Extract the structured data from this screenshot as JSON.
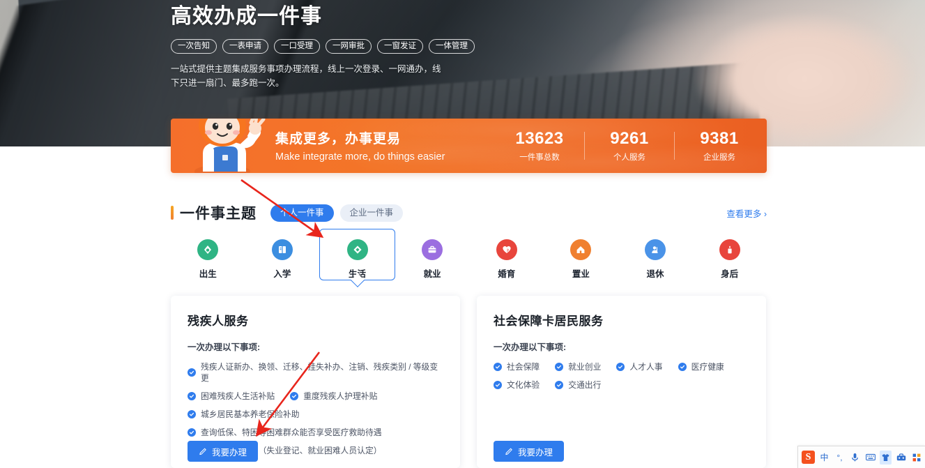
{
  "hero": {
    "title": "高效办成一件事",
    "tags": [
      "一次告知",
      "一表申请",
      "一口受理",
      "一网审批",
      "一窗发证",
      "一体管理"
    ],
    "description": "一站式提供主题集成服务事项办理流程，线上一次登录、一网通办，线下只进一扇门、最多跑一次。"
  },
  "banner": {
    "title": "集成更多，办事更易",
    "subtitle": "Make integrate more, do things easier",
    "mascot_icon": "mascot-character-icon",
    "stats": [
      {
        "value": "13623",
        "label": "一件事总数"
      },
      {
        "value": "9261",
        "label": "个人服务"
      },
      {
        "value": "9381",
        "label": "企业服务"
      }
    ]
  },
  "section": {
    "title": "一件事主题",
    "tabs": [
      {
        "label": "个人一件事",
        "active": true
      },
      {
        "label": "企业一件事",
        "active": false
      }
    ],
    "more_label": "查看更多",
    "more_icon": "chevron-right-icon"
  },
  "categories": [
    {
      "label": "出生",
      "icon": "birth-drop-icon",
      "color": "#2fb484",
      "selected": false
    },
    {
      "label": "入学",
      "icon": "book-icon",
      "color": "#3c8ee0",
      "selected": false
    },
    {
      "label": "生活",
      "icon": "life-diamond-icon",
      "color": "#2fb484",
      "selected": true
    },
    {
      "label": "就业",
      "icon": "briefcase-icon",
      "color": "#9b6ee0",
      "selected": false
    },
    {
      "label": "婚育",
      "icon": "heart-icon",
      "color": "#e8453c",
      "selected": false
    },
    {
      "label": "置业",
      "icon": "house-icon",
      "color": "#f08030",
      "selected": false
    },
    {
      "label": "退休",
      "icon": "retire-person-icon",
      "color": "#4a93e8",
      "selected": false
    },
    {
      "label": "身后",
      "icon": "candle-icon",
      "color": "#e8453c",
      "selected": false
    }
  ],
  "cards": [
    {
      "title": "残疾人服务",
      "subtitle": "一次办理以下事项:",
      "items": [
        "残疾人证新办、换领、迁移、挂失补办、注销、残疾类别 / 等级变更"
      ],
      "inline_rows": [
        [
          "困难残疾人生活补贴",
          "重度残疾人护理补贴"
        ]
      ],
      "more_items": [
        "城乡居民基本养老保险补助",
        "查询低保、特困等困难群众能否享受医疗救助待遇",
        "残疾人就业帮扶（失业登记、就业困难人员认定）"
      ],
      "button_label": "我要办理",
      "button_icon": "pencil-icon"
    },
    {
      "title": "社会保障卡居民服务",
      "subtitle": "一次办理以下事项:",
      "items": [],
      "inline_rows": [
        [
          "社会保障",
          "就业创业",
          "人才人事",
          "医疗健康"
        ],
        [
          "文化体验",
          "交通出行"
        ]
      ],
      "more_items": [],
      "button_label": "我要办理",
      "button_icon": "pencil-icon"
    }
  ],
  "annotations": {
    "arrow_1": "red-arrow-pointing-to-life-category",
    "arrow_2": "red-arrow-pointing-to-apply-button"
  },
  "ime": {
    "logo": "S",
    "items": [
      {
        "icon": "chinese-mode-icon",
        "glyph": "中"
      },
      {
        "icon": "punctuation-icon",
        "glyph": "°,"
      },
      {
        "icon": "microphone-icon",
        "glyph": "🎤"
      },
      {
        "icon": "keyboard-icon",
        "glyph": "⌨"
      },
      {
        "icon": "skin-icon",
        "glyph": "👕"
      },
      {
        "icon": "toolbox-icon",
        "glyph": "🧰"
      },
      {
        "icon": "apps-grid-icon",
        "glyph": "▦"
      }
    ]
  },
  "colors": {
    "accent_blue": "#2f7ced",
    "banner_orange": "#f06a26",
    "text_dark": "#1b2129",
    "annotation_red": "#e8251c"
  }
}
